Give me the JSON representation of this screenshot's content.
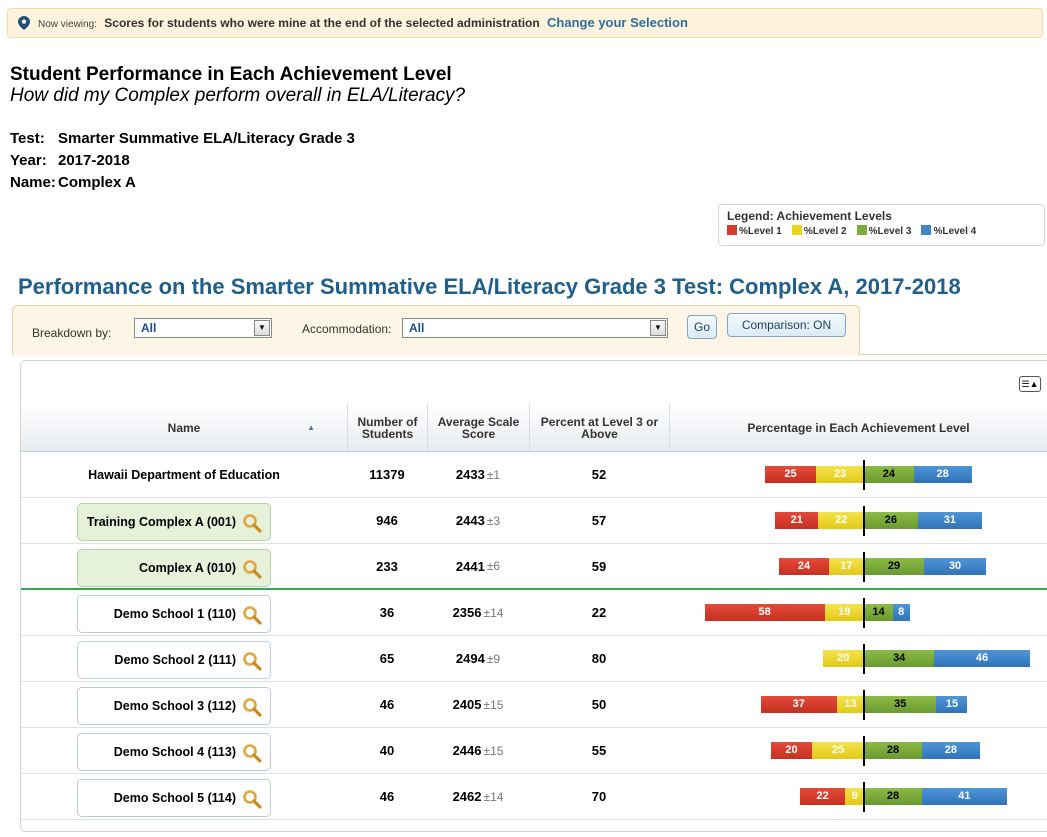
{
  "viewing": {
    "prefix": "Now viewing:",
    "description": "Scores for students who were mine at the end of the selected administration",
    "change_link": "Change your Selection"
  },
  "report": {
    "title": "Student Performance in Each Achievement Level",
    "subtitle": "How did my Complex perform overall in ELA/Literacy?",
    "test_label": "Test:",
    "test_value": "Smarter Summative ELA/Literacy Grade 3",
    "year_label": "Year:",
    "year_value": "2017-2018",
    "name_label": "Name:",
    "name_value": "Complex A"
  },
  "legend": {
    "title": "Legend: Achievement Levels",
    "items": [
      {
        "label": "%Level 1",
        "color": "#d63a2a"
      },
      {
        "label": "%Level 2",
        "color": "#eed21f"
      },
      {
        "label": "%Level 3",
        "color": "#7aab3c"
      },
      {
        "label": "%Level 4",
        "color": "#3f86c9"
      }
    ]
  },
  "performance_title": "Performance on the Smarter Summative ELA/Literacy Grade 3 Test: Complex A, 2017-2018",
  "controls": {
    "breakdown_label": "Breakdown by:",
    "breakdown_value": "All",
    "accommodation_label": "Accommodation:",
    "accommodation_value": "All",
    "go_button": "Go",
    "comparison_button": "Comparison: ON"
  },
  "table": {
    "headers": {
      "name": "Name",
      "num_students": "Number of Students",
      "avg_scale": "Average Scale Score",
      "percent_l3": "Percent at Level 3 or Above",
      "pct_each": "Percentage in Each Achievement Level"
    },
    "rows": [
      {
        "name": "Hawaii Department of Education",
        "style": "plain",
        "students": "11379",
        "avg": "2433",
        "err": "±1",
        "pct": "52",
        "levels": [
          25,
          23,
          24,
          28
        ]
      },
      {
        "name": "Training Complex A (001)",
        "style": "green",
        "students": "946",
        "avg": "2443",
        "err": "±3",
        "pct": "57",
        "levels": [
          21,
          22,
          26,
          31
        ]
      },
      {
        "name": "Complex A (010)",
        "style": "green",
        "students": "233",
        "avg": "2441",
        "err": "±6",
        "pct": "59",
        "levels": [
          24,
          17,
          29,
          30
        ]
      },
      {
        "name": "Demo School 1 (110)",
        "style": "box",
        "students": "36",
        "avg": "2356",
        "err": "±14",
        "pct": "22",
        "levels": [
          58,
          19,
          14,
          8
        ]
      },
      {
        "name": "Demo School 2 (111)",
        "style": "box",
        "students": "65",
        "avg": "2494",
        "err": "±9",
        "pct": "80",
        "levels": [
          0,
          20,
          34,
          46
        ]
      },
      {
        "name": "Demo School 3 (112)",
        "style": "box",
        "students": "46",
        "avg": "2405",
        "err": "±15",
        "pct": "50",
        "levels": [
          37,
          13,
          35,
          15
        ]
      },
      {
        "name": "Demo School 4 (113)",
        "style": "box",
        "students": "40",
        "avg": "2446",
        "err": "±15",
        "pct": "55",
        "levels": [
          20,
          25,
          28,
          28
        ]
      },
      {
        "name": "Demo School 5 (114)",
        "style": "box",
        "students": "46",
        "avg": "2462",
        "err": "±14",
        "pct": "70",
        "levels": [
          22,
          9,
          28,
          41
        ]
      }
    ]
  }
}
